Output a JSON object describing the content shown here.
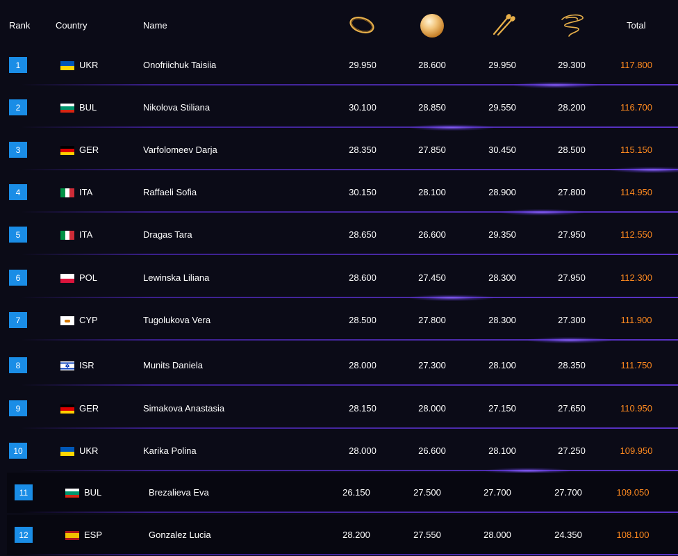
{
  "header": {
    "rank": "Rank",
    "country": "Country",
    "name": "Name",
    "total": "Total",
    "apparatus_icons": [
      "hoop-icon",
      "ball-icon",
      "clubs-icon",
      "ribbon-icon"
    ]
  },
  "colors": {
    "background": "#0b0b17",
    "rank_badge": "#1a8de6",
    "total_text": "#ff8a1f",
    "divider": "#4a2aa8",
    "apparatus_gold": "#e8b04a"
  },
  "rows": [
    {
      "rank": "1",
      "country": "UKR",
      "flag": "ukraine-flag-icon",
      "name": "Onofriichuk Taisiia",
      "hoop": "29.950",
      "ball": "28.600",
      "clubs": "29.950",
      "ribbon": "29.300",
      "total": "117.800"
    },
    {
      "rank": "2",
      "country": "BUL",
      "flag": "bulgaria-flag-icon",
      "name": "Nikolova Stiliana",
      "hoop": "30.100",
      "ball": "28.850",
      "clubs": "29.550",
      "ribbon": "28.200",
      "total": "116.700"
    },
    {
      "rank": "3",
      "country": "GER",
      "flag": "germany-flag-icon",
      "name": "Varfolomeev Darja",
      "hoop": "28.350",
      "ball": "27.850",
      "clubs": "30.450",
      "ribbon": "28.500",
      "total": "115.150"
    },
    {
      "rank": "4",
      "country": "ITA",
      "flag": "italy-flag-icon",
      "name": "Raffaeli Sofia",
      "hoop": "30.150",
      "ball": "28.100",
      "clubs": "28.900",
      "ribbon": "27.800",
      "total": "114.950"
    },
    {
      "rank": "5",
      "country": "ITA",
      "flag": "italy-flag-icon",
      "name": "Dragas Tara",
      "hoop": "28.650",
      "ball": "26.600",
      "clubs": "29.350",
      "ribbon": "27.950",
      "total": "112.550"
    },
    {
      "rank": "6",
      "country": "POL",
      "flag": "poland-flag-icon",
      "name": "Lewinska Liliana",
      "hoop": "28.600",
      "ball": "27.450",
      "clubs": "28.300",
      "ribbon": "27.950",
      "total": "112.300"
    },
    {
      "rank": "7",
      "country": "CYP",
      "flag": "cyprus-flag-icon",
      "name": "Tugolukova Vera",
      "hoop": "28.500",
      "ball": "27.800",
      "clubs": "28.300",
      "ribbon": "27.300",
      "total": "111.900"
    },
    {
      "rank": "8",
      "country": "ISR",
      "flag": "israel-flag-icon",
      "name": "Munits Daniela",
      "hoop": "28.000",
      "ball": "27.300",
      "clubs": "28.100",
      "ribbon": "28.350",
      "total": "111.750"
    },
    {
      "rank": "9",
      "country": "GER",
      "flag": "germany-flag-icon",
      "name": "Simakova Anastasia",
      "hoop": "28.150",
      "ball": "28.000",
      "clubs": "27.150",
      "ribbon": "27.650",
      "total": "110.950"
    },
    {
      "rank": "10",
      "country": "UKR",
      "flag": "ukraine-flag-icon",
      "name": "Karika Polina",
      "hoop": "28.000",
      "ball": "26.600",
      "clubs": "28.100",
      "ribbon": "27.250",
      "total": "109.950"
    },
    {
      "rank": "11",
      "country": "BUL",
      "flag": "bulgaria-flag-icon",
      "name": "Brezalieva Eva",
      "hoop": "26.150",
      "ball": "27.500",
      "clubs": "27.700",
      "ribbon": "27.700",
      "total": "109.050"
    },
    {
      "rank": "12",
      "country": "ESP",
      "flag": "spain-flag-icon",
      "name": "Gonzalez Lucia",
      "hoop": "28.200",
      "ball": "27.550",
      "clubs": "28.000",
      "ribbon": "24.350",
      "total": "108.100"
    }
  ]
}
